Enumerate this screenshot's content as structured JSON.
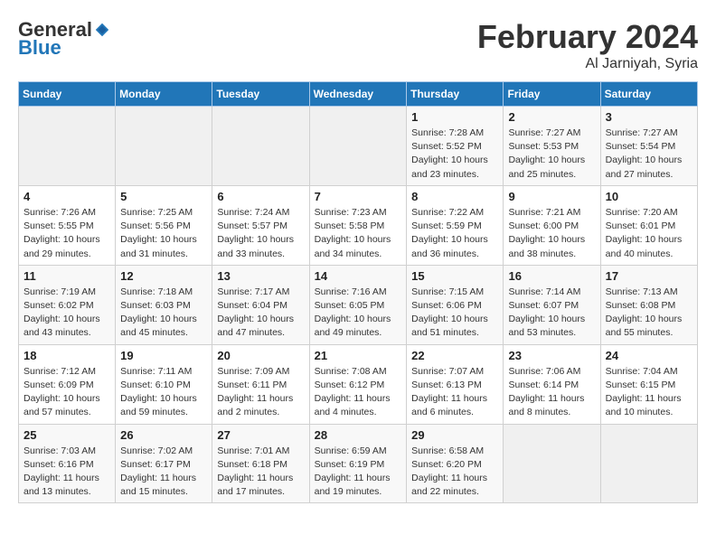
{
  "logo": {
    "general": "General",
    "blue": "Blue"
  },
  "title": "February 2024",
  "location": "Al Jarniyah, Syria",
  "days_header": [
    "Sunday",
    "Monday",
    "Tuesday",
    "Wednesday",
    "Thursday",
    "Friday",
    "Saturday"
  ],
  "weeks": [
    [
      {
        "day": "",
        "info": ""
      },
      {
        "day": "",
        "info": ""
      },
      {
        "day": "",
        "info": ""
      },
      {
        "day": "",
        "info": ""
      },
      {
        "day": "1",
        "info": "Sunrise: 7:28 AM\nSunset: 5:52 PM\nDaylight: 10 hours\nand 23 minutes."
      },
      {
        "day": "2",
        "info": "Sunrise: 7:27 AM\nSunset: 5:53 PM\nDaylight: 10 hours\nand 25 minutes."
      },
      {
        "day": "3",
        "info": "Sunrise: 7:27 AM\nSunset: 5:54 PM\nDaylight: 10 hours\nand 27 minutes."
      }
    ],
    [
      {
        "day": "4",
        "info": "Sunrise: 7:26 AM\nSunset: 5:55 PM\nDaylight: 10 hours\nand 29 minutes."
      },
      {
        "day": "5",
        "info": "Sunrise: 7:25 AM\nSunset: 5:56 PM\nDaylight: 10 hours\nand 31 minutes."
      },
      {
        "day": "6",
        "info": "Sunrise: 7:24 AM\nSunset: 5:57 PM\nDaylight: 10 hours\nand 33 minutes."
      },
      {
        "day": "7",
        "info": "Sunrise: 7:23 AM\nSunset: 5:58 PM\nDaylight: 10 hours\nand 34 minutes."
      },
      {
        "day": "8",
        "info": "Sunrise: 7:22 AM\nSunset: 5:59 PM\nDaylight: 10 hours\nand 36 minutes."
      },
      {
        "day": "9",
        "info": "Sunrise: 7:21 AM\nSunset: 6:00 PM\nDaylight: 10 hours\nand 38 minutes."
      },
      {
        "day": "10",
        "info": "Sunrise: 7:20 AM\nSunset: 6:01 PM\nDaylight: 10 hours\nand 40 minutes."
      }
    ],
    [
      {
        "day": "11",
        "info": "Sunrise: 7:19 AM\nSunset: 6:02 PM\nDaylight: 10 hours\nand 43 minutes."
      },
      {
        "day": "12",
        "info": "Sunrise: 7:18 AM\nSunset: 6:03 PM\nDaylight: 10 hours\nand 45 minutes."
      },
      {
        "day": "13",
        "info": "Sunrise: 7:17 AM\nSunset: 6:04 PM\nDaylight: 10 hours\nand 47 minutes."
      },
      {
        "day": "14",
        "info": "Sunrise: 7:16 AM\nSunset: 6:05 PM\nDaylight: 10 hours\nand 49 minutes."
      },
      {
        "day": "15",
        "info": "Sunrise: 7:15 AM\nSunset: 6:06 PM\nDaylight: 10 hours\nand 51 minutes."
      },
      {
        "day": "16",
        "info": "Sunrise: 7:14 AM\nSunset: 6:07 PM\nDaylight: 10 hours\nand 53 minutes."
      },
      {
        "day": "17",
        "info": "Sunrise: 7:13 AM\nSunset: 6:08 PM\nDaylight: 10 hours\nand 55 minutes."
      }
    ],
    [
      {
        "day": "18",
        "info": "Sunrise: 7:12 AM\nSunset: 6:09 PM\nDaylight: 10 hours\nand 57 minutes."
      },
      {
        "day": "19",
        "info": "Sunrise: 7:11 AM\nSunset: 6:10 PM\nDaylight: 10 hours\nand 59 minutes."
      },
      {
        "day": "20",
        "info": "Sunrise: 7:09 AM\nSunset: 6:11 PM\nDaylight: 11 hours\nand 2 minutes."
      },
      {
        "day": "21",
        "info": "Sunrise: 7:08 AM\nSunset: 6:12 PM\nDaylight: 11 hours\nand 4 minutes."
      },
      {
        "day": "22",
        "info": "Sunrise: 7:07 AM\nSunset: 6:13 PM\nDaylight: 11 hours\nand 6 minutes."
      },
      {
        "day": "23",
        "info": "Sunrise: 7:06 AM\nSunset: 6:14 PM\nDaylight: 11 hours\nand 8 minutes."
      },
      {
        "day": "24",
        "info": "Sunrise: 7:04 AM\nSunset: 6:15 PM\nDaylight: 11 hours\nand 10 minutes."
      }
    ],
    [
      {
        "day": "25",
        "info": "Sunrise: 7:03 AM\nSunset: 6:16 PM\nDaylight: 11 hours\nand 13 minutes."
      },
      {
        "day": "26",
        "info": "Sunrise: 7:02 AM\nSunset: 6:17 PM\nDaylight: 11 hours\nand 15 minutes."
      },
      {
        "day": "27",
        "info": "Sunrise: 7:01 AM\nSunset: 6:18 PM\nDaylight: 11 hours\nand 17 minutes."
      },
      {
        "day": "28",
        "info": "Sunrise: 6:59 AM\nSunset: 6:19 PM\nDaylight: 11 hours\nand 19 minutes."
      },
      {
        "day": "29",
        "info": "Sunrise: 6:58 AM\nSunset: 6:20 PM\nDaylight: 11 hours\nand 22 minutes."
      },
      {
        "day": "",
        "info": ""
      },
      {
        "day": "",
        "info": ""
      }
    ]
  ]
}
